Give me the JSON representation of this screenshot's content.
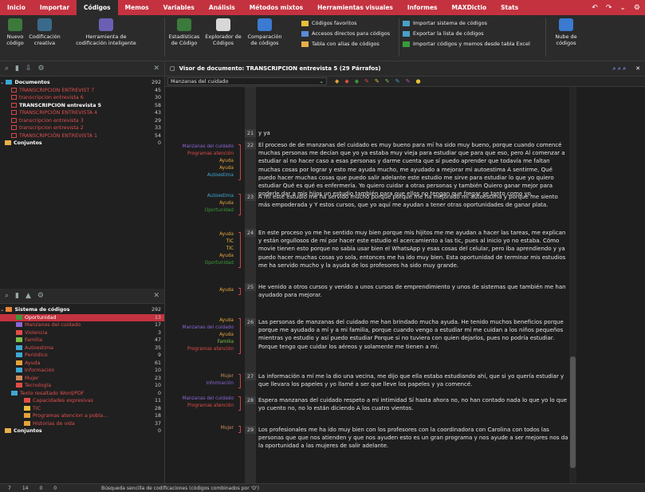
{
  "menubar": {
    "items": [
      "Inicio",
      "Importar",
      "Códigos",
      "Memos",
      "Variables",
      "Análisis",
      "Métodos mixtos",
      "Herramientas visuales",
      "Informes",
      "MAXDictio",
      "Stats"
    ],
    "active_index": 2
  },
  "ribbon": {
    "nuevo_codigo": "Nuevo\ncódigo",
    "codificacion_creativa": "Codificación\ncreativa",
    "herramienta_codificacion": "Herramienta de\ncodificación inteligente",
    "estadisticas": "Estadísticas\nde Código",
    "explorador_codigos": "Explorador de\nCódigos",
    "comparacion_codigos": "Comparación\nde códigos",
    "list1": [
      "Códigos favoritos",
      "Accesos directos para códigos",
      "Tabla con alias de códigos"
    ],
    "list2": [
      "Importar sistema de códigos",
      "Exportar la lista de códigos",
      "Importar códigos y memos desde tabla Excel"
    ],
    "nube_codigos": "Nube de\ncódigos"
  },
  "documents": {
    "header": {
      "label": "Documentos",
      "count": "292"
    },
    "items": [
      {
        "label": "TRANSCRIPCION ENTREVIST 7",
        "count": "45",
        "bold": false
      },
      {
        "label": "transcripcion entrevista 6",
        "count": "30",
        "bold": false
      },
      {
        "label": "TRANSCRIPCION entrevista 5",
        "count": "58",
        "bold": true
      },
      {
        "label": "TRANSCRIPCIÓN ENTREVISTA 4",
        "count": "43",
        "bold": false
      },
      {
        "label": "transcripcion entrevista 3",
        "count": "29",
        "bold": false
      },
      {
        "label": "transcripcion entrevista 2",
        "count": "33",
        "bold": false
      },
      {
        "label": "TRANSCRIPCIÓN ENTREVISTA 1",
        "count": "54",
        "bold": false
      }
    ],
    "sets": {
      "label": "Conjuntos",
      "count": "0"
    }
  },
  "codes": {
    "header": {
      "label": "Sistema de códigos",
      "count": "292"
    },
    "items": [
      {
        "label": "Oportunidad",
        "count": "13"
      },
      {
        "label": "Manzanas del cuidado",
        "count": "17"
      },
      {
        "label": "Violencia",
        "count": "3"
      },
      {
        "label": "Familia",
        "count": "47"
      },
      {
        "label": "Autoestima",
        "count": "35"
      },
      {
        "label": "Periódico",
        "count": "9"
      },
      {
        "label": "Ayuda",
        "count": "61"
      },
      {
        "label": "Información",
        "count": "10"
      },
      {
        "label": "Mujer",
        "count": "23"
      },
      {
        "label": "Tecnología",
        "count": "10"
      },
      {
        "label": "Texto resaltado Word/PDF",
        "count": "0"
      },
      {
        "label": "Capacidades expresivas",
        "count": "11"
      },
      {
        "label": "TIC",
        "count": "28"
      },
      {
        "label": "Programas atencion a pobla...",
        "count": "18"
      },
      {
        "label": "Historias de vida",
        "count": "37"
      }
    ],
    "sets": {
      "label": "Conjuntos",
      "count": "0"
    }
  },
  "viewer": {
    "title": "Visor de documento: TRANSCRIPCION entrevista 5  (29 Párrafos)",
    "dropdown": "Manzanas del cuidado",
    "paragraphs": [
      {
        "n": "21",
        "text": "y ya"
      },
      {
        "n": "22",
        "text": "El proceso de de manzanas del cuidado es muy bueno para mí ha sido muy bueno, porque cuando comencé muchas personas me decían que yo ya estaba muy vieja para estudiar que para que eso, pero Al comenzar a estudiar al no hacer caso a esas personas y darme cuenta que sí puedo aprender que todavía me faltan muchas cosas por lograr y esto me ayuda mucho, me ayudado a mejorar mi autoestima A sentirme, Qué puedo hacer muchas cosas que puedo salir adelante este estudio me sirve para estudiar lo que yo quiero estudiar Qué es qué es enfermería. Yo quiero cuidar a otras personas y también Quiero ganar mejor para poderle dar a mis hijos un estudio también para que ellos no tengan que fregar se tanto como yo."
      },
      {
        "n": "23",
        "text": "A mí este estudio me ha servido mucho porque porque me ha mejorado mi autoestima y porque me siento más empoderada y Y estos cursos, que yo aquí me ayudan a tener otras oportunidades de ganar plata."
      },
      {
        "n": "24",
        "text": "En este proceso yo me he sentido muy bien porque mis hijitos me me ayudan a hacer las tareas, me explican y están orgullosos de mí por hacer este estudio el acercamiento a las tic, pues al inicio yo no estaba. Cómo movie tienen esto porque no sabía usar bien el WhatsApp y esas cosas del celular, pero iba aprendiendo y ya puedo hacer muchas cosas yo sola, entonces me ha ido muy bien. Esta oportunidad de terminar mis estudios me ha servido mucho y la ayuda de los profesores ha sido muy grande."
      },
      {
        "n": "25",
        "text": "He venido a otros cursos y venido a unos cursos de emprendimiento y unos de sistemas que también me han ayudado para mejorar."
      },
      {
        "n": "26",
        "text": "Las personas de manzanas del cuidado me han brindado mucha ayuda. He tenido muchos beneficios porque porque me ayudado a mí y a mi familia, porque cuando vengo a estudiar mí me cuidan a los niños pequeños mientras yo estudio y así puedo estudiar Porque si no tuviera con quien dejarlos, pues no podría estudiar. Porque tengo que cuidar los aéreos y solamente me tienen a mí."
      },
      {
        "n": "27",
        "text": "La información a mí me la dio una vecina, me dijo que ella estaba estudiando ahí, que si yo quería estudiar y que llevara los papeles y yo llamé a ser que lleve los papeles y ya comencé."
      },
      {
        "n": "28",
        "text": "Espera manzanas del cuidado respeto a mi intimidad Sí hasta ahora no, no han contado nada lo que yo lo que yo cuento no, no lo están diciendo A los cuatro vientos."
      },
      {
        "n": "29",
        "text": "Los profesionales me ha ido muy bien con los profesores con la coordinadora con Carolina con todos las personas que que nos atienden y que nos ayuden esto es un gran programa y nos ayude a ser mejores nos da la oportunidad a las mujeres de salir adelante."
      }
    ],
    "code_labels": {
      "p22": [
        "Manzanas del cuidado",
        "Programas atención",
        "Ayuda",
        "Ayuda",
        "Autoestima"
      ],
      "p23": [
        "Autoestima",
        "Ayuda",
        "Oportunidad"
      ],
      "p24": [
        "Ayuda",
        "TIC",
        "TIC",
        "Ayuda",
        "Oportunidad"
      ],
      "p25": [
        "Ayuda"
      ],
      "p26": [
        "Ayuda",
        "Manzanas del cuidado",
        "Ayuda",
        "Familia",
        "Programas atención"
      ],
      "p27": [
        "Mujer",
        "Información"
      ],
      "p28": [
        "Manzanas del cuidado",
        "Programas atención"
      ],
      "p29": [
        "Mujer"
      ]
    }
  },
  "statusbar": {
    "items": [
      "7",
      "14",
      "0",
      "0",
      "",
      "",
      "",
      "Búsqueda sencilla de codificaciones (códigos combinados por 'O')"
    ]
  },
  "colors": {
    "menubar": "#c4323f",
    "selection": "#c4323f",
    "oportunidad": "#3a9a3a",
    "ayuda": "#e3a33a",
    "autoestima": "#3fa8d4",
    "programas": "#e24d47",
    "manzanas": "#8a66d6"
  }
}
